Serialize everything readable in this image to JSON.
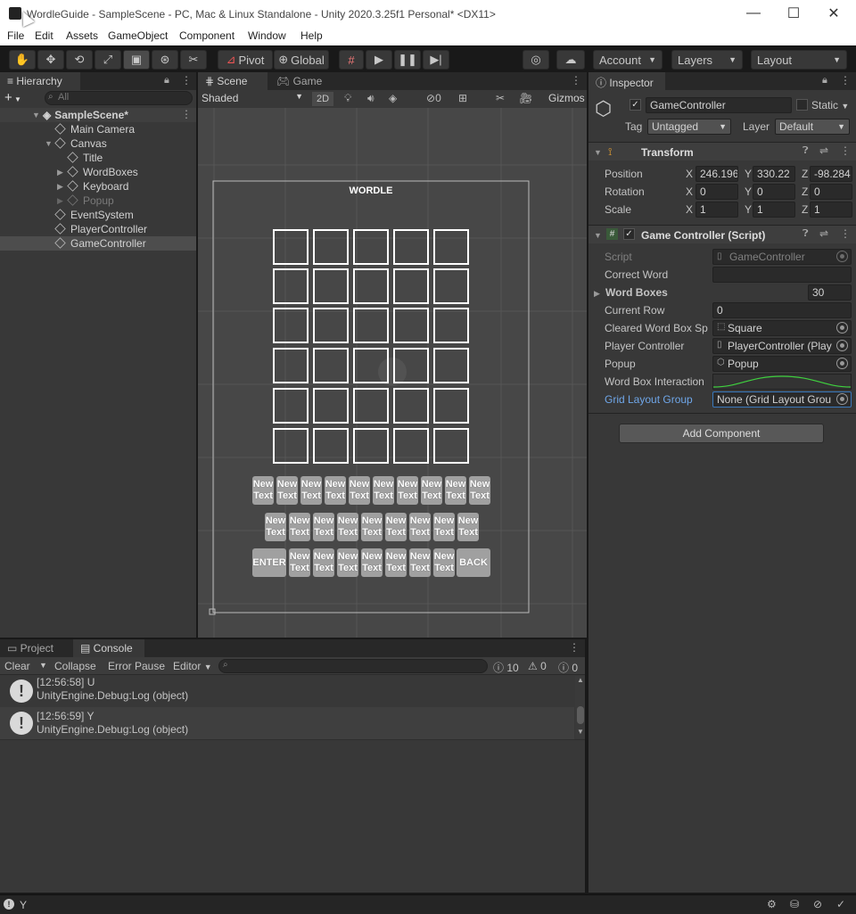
{
  "window": {
    "title": "WordleGuide - SampleScene - PC, Mac & Linux Standalone - Unity 2020.3.25f1 Personal* <DX11>",
    "min": "—",
    "max": "☐",
    "close": "✕"
  },
  "menu": [
    "File",
    "Edit",
    "Assets",
    "GameObject",
    "Component",
    "Window",
    "Help"
  ],
  "toolbar": {
    "pivot": "Pivot",
    "global": "Global",
    "account": "Account",
    "layers": "Layers",
    "layout": "Layout"
  },
  "hierarchy": {
    "tab": "Hierarchy",
    "search_placeholder": "All",
    "scene": "SampleScene*",
    "items": [
      "Main Camera",
      "Canvas",
      "Title",
      "WordBoxes",
      "Keyboard",
      "Popup",
      "EventSystem",
      "PlayerController",
      "GameController"
    ]
  },
  "scene": {
    "tab_scene": "Scene",
    "tab_game": "Game",
    "shading": "Shaded",
    "mode2d": "2D",
    "hidden_count": "0",
    "gizmos": "Gizmos",
    "wordle_title": "WORDLE",
    "key_label_1": "New",
    "key_label_2": "Text",
    "enter": "ENTER",
    "back": "BACK"
  },
  "inspector": {
    "tab": "Inspector",
    "object_name": "GameController",
    "static": "Static",
    "tag_label": "Tag",
    "tag": "Untagged",
    "layer_label": "Layer",
    "layer": "Default",
    "transform": {
      "title": "Transform",
      "position": {
        "label": "Position",
        "x": "246.196",
        "y": "330.22",
        "z": "-98.284"
      },
      "rotation": {
        "label": "Rotation",
        "x": "0",
        "y": "0",
        "z": "0"
      },
      "scale": {
        "label": "Scale",
        "x": "1",
        "y": "1",
        "z": "1"
      }
    },
    "script_comp": {
      "title": "Game Controller (Script)",
      "script_label": "Script",
      "script": "GameController",
      "correct_word_label": "Correct Word",
      "correct_word": "",
      "word_boxes_label": "Word Boxes",
      "word_boxes": "30",
      "current_row_label": "Current Row",
      "current_row": "0",
      "cleared_label": "Cleared Word Box Sp",
      "cleared": "Square",
      "player_label": "Player Controller",
      "player": "PlayerController (Play",
      "popup_label": "Popup",
      "popup": "Popup",
      "interaction_label": "Word Box Interaction",
      "grid_label": "Grid Layout Group",
      "grid": "None (Grid Layout Grou"
    },
    "add_component": "Add Component"
  },
  "console": {
    "tab_project": "Project",
    "tab_console": "Console",
    "clear": "Clear",
    "collapse": "Collapse",
    "error_pause": "Error Pause",
    "editor": "Editor",
    "count_log": "10",
    "count_warn": "0",
    "count_err": "0",
    "entries": [
      {
        "line1": "[12:56:58] U",
        "line2": "UnityEngine.Debug:Log (object)"
      },
      {
        "line1": "[12:56:59] Y",
        "line2": "UnityEngine.Debug:Log (object)"
      }
    ]
  },
  "status": {
    "text": "Y"
  }
}
